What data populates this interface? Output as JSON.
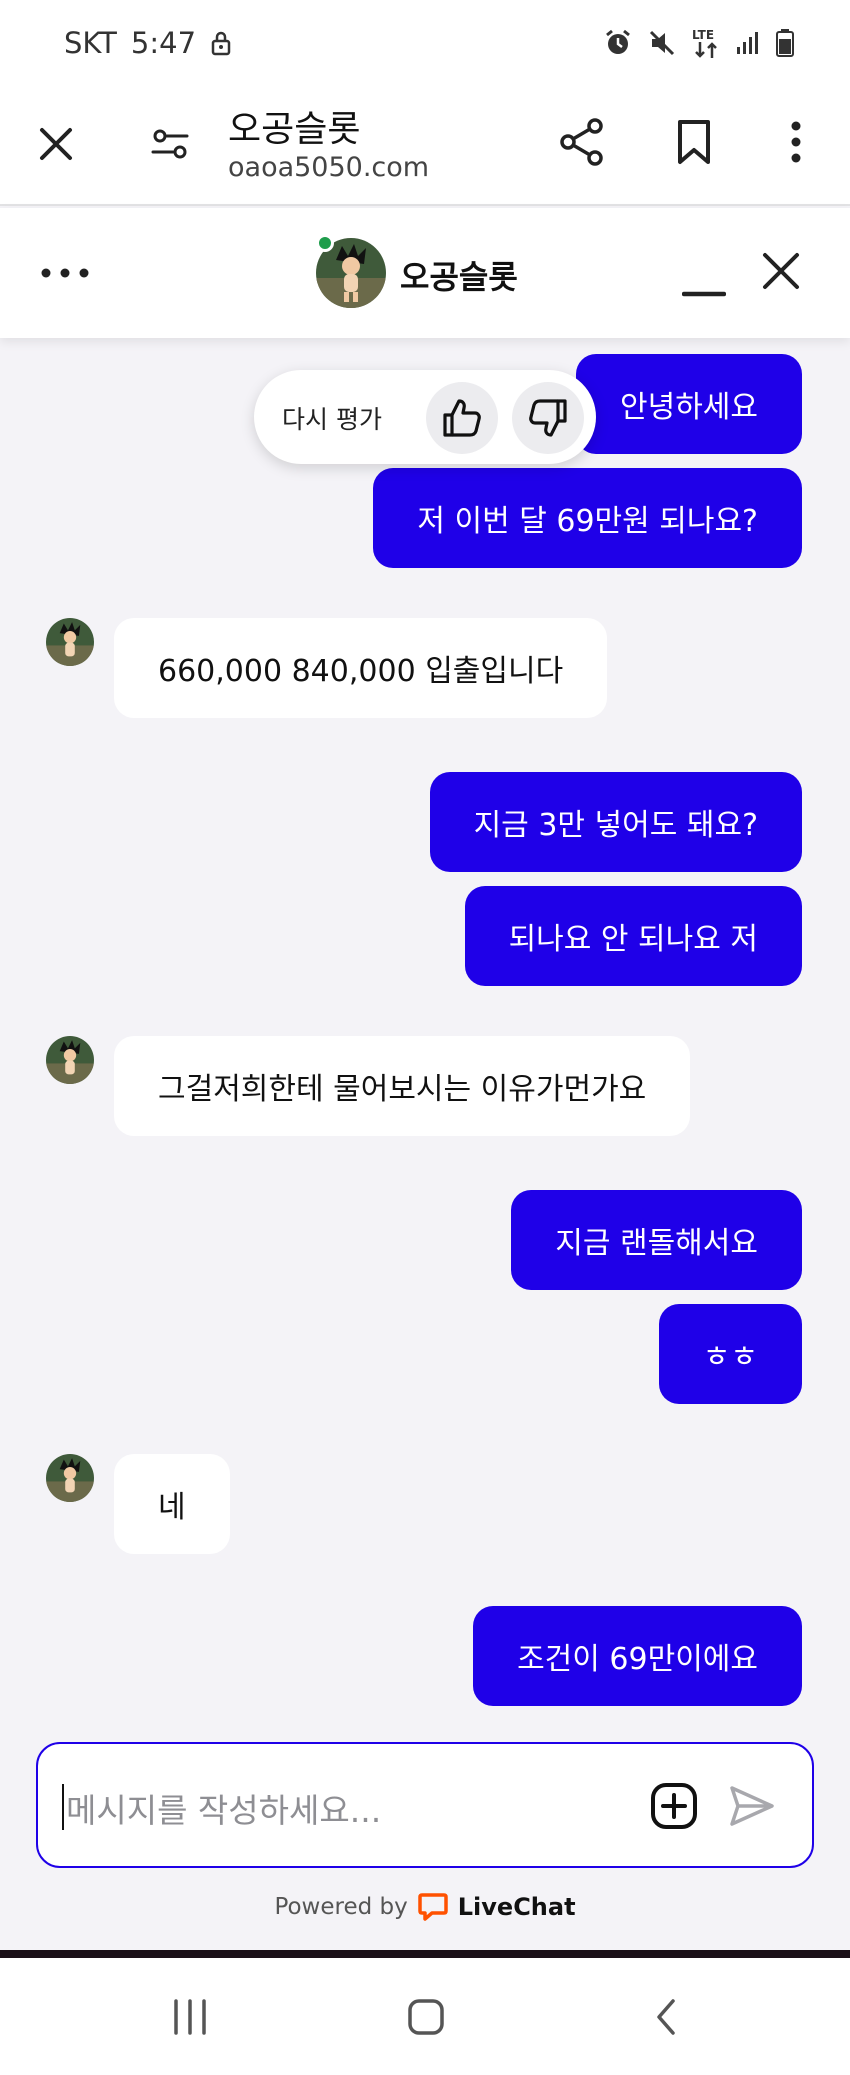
{
  "status_bar": {
    "carrier": "SKT",
    "time": "5:47",
    "network": "LTE",
    "icons": [
      "lock-icon",
      "alarm-icon",
      "mute-icon",
      "lte-icon",
      "signal-icon",
      "battery-icon"
    ]
  },
  "browser": {
    "site_title": "오공슬롯",
    "url": "oaoa5050.com",
    "icons": [
      "close-icon",
      "site-settings-icon",
      "share-icon",
      "bookmark-icon",
      "more-vertical-icon"
    ]
  },
  "chat_header": {
    "title": "오공슬롯",
    "status_color": "#1f9d4c",
    "icons": [
      "more-horizontal-icon",
      "minimize-icon",
      "close-icon"
    ]
  },
  "rating": {
    "label": "다시 평가",
    "icons": [
      "thumbs-up-icon",
      "thumbs-down-icon"
    ]
  },
  "messages": [
    {
      "from": "visitor",
      "text": "안녕하세요"
    },
    {
      "from": "visitor",
      "text": "저 이번 달 69만원 되나요?"
    },
    {
      "from": "agent",
      "text": "660,000 840,000 입출입니다"
    },
    {
      "from": "visitor",
      "text": "지금 3만 넣어도 돼요?"
    },
    {
      "from": "visitor",
      "text": "되나요 안 되나요 저"
    },
    {
      "from": "agent",
      "text": "그걸저희한테 물어보시는 이유가먼가요"
    },
    {
      "from": "visitor",
      "text": "지금 랜돌해서요"
    },
    {
      "from": "visitor",
      "text": "ㅎㅎ"
    },
    {
      "from": "agent",
      "text": "네"
    },
    {
      "from": "visitor",
      "text": "조건이 69만이에요"
    }
  ],
  "composer": {
    "placeholder": "메시지를 작성하세요...",
    "icons": [
      "add-attachment-icon",
      "send-icon"
    ]
  },
  "powered_by": {
    "label": "Powered by",
    "brand": "LiveChat",
    "brand_color": "#ff5100"
  },
  "nav_bar": {
    "icons": [
      "recent-apps-icon",
      "home-icon",
      "back-icon"
    ]
  },
  "colors": {
    "accent": "#1f00e8",
    "background": "#f4f3f7"
  }
}
